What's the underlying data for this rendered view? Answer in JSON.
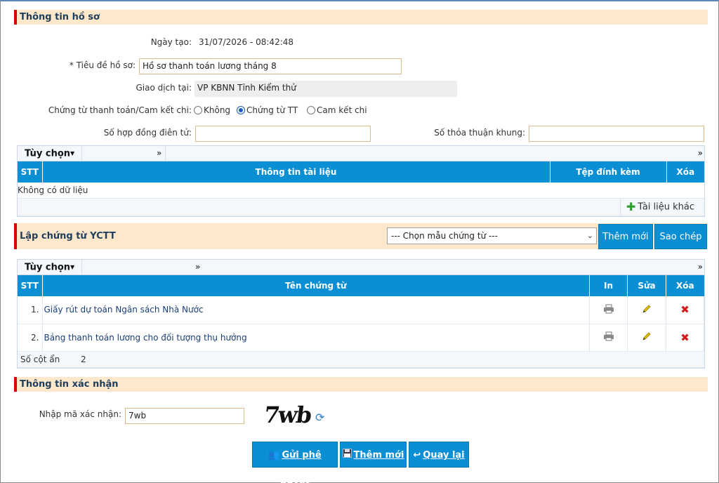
{
  "section1": {
    "title": "Thông tin hồ sơ",
    "created_label": "Ngày tạo:",
    "created_value": "31/07/2026 - 08:42:48",
    "title_label": "* Tiêu đề hồ sơ:",
    "title_value": "Hồ sơ thanh toán lương tháng 8",
    "transact_label": "Giao dịch tại:",
    "transact_value": "VP KBNN Tỉnh Kiểm thử",
    "voucher_label": "Chứng từ thanh toán/Cam kết chi:",
    "radio_options": [
      "Không",
      "Chứng từ TT",
      "Cam kết chi"
    ],
    "radio_selected": "Chứng từ TT",
    "contract_label": "Số hợp đồng điên tử:",
    "framework_label": "Số thỏa thuận khung:"
  },
  "grid1": {
    "options_label": "Tùy chọn",
    "more": "»",
    "columns": [
      "STT",
      "Thông tin tài liệu",
      "Tệp đính kèm",
      "Xóa"
    ],
    "empty_text": "Không có dữ liệu",
    "other_docs_button": "Tài liệu khác"
  },
  "section2": {
    "title": "Lập chứng từ YCTT",
    "template_select": "--- Chọn mẫu chứng từ ---",
    "add_button": "Thêm mới",
    "copy_button": "Sao chép"
  },
  "grid2": {
    "options_label": "Tùy chọn",
    "more": "»",
    "columns": [
      "STT",
      "Tên chứng từ",
      "In",
      "Sửa",
      "Xóa"
    ],
    "rows": [
      {
        "stt": "1.",
        "name": "Giấy rút dự toán Ngân sách Nhà Nước"
      },
      {
        "stt": "2.",
        "name": "Bảng thanh toán lương cho đối tượng thụ hưởng"
      }
    ],
    "footer_label": "Số cột ẩn",
    "footer_value": "2"
  },
  "section3": {
    "title": "Thông tin xác nhận",
    "captcha_label": "Nhập mã xác nhận:",
    "captcha_input": "7wb",
    "captcha_image_text": "7wb"
  },
  "actions": {
    "submit": "Gửi phê duyệt",
    "add_new": "Thêm mới",
    "back": "Quay lại"
  },
  "colors": {
    "accent": "#0a8ed4",
    "section_bg": "#fde8cc",
    "section_marker": "#d40000",
    "delete_icon": "#cc1f1f"
  }
}
